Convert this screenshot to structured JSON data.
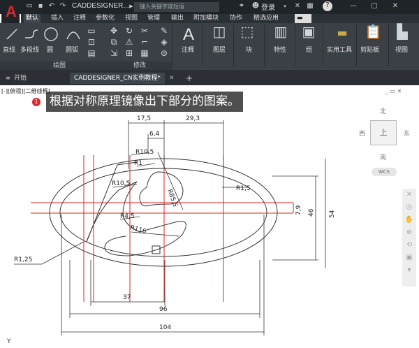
{
  "titlebar": {
    "app_title": "CADDESIGNER...",
    "search_placeholder": "键入关键字或短语",
    "login": "登录",
    "help": "?"
  },
  "menu_tabs": [
    "默认",
    "插入",
    "注释",
    "参数化",
    "视图",
    "管理",
    "输出",
    "附加模块",
    "协作",
    "精选应用"
  ],
  "ribbon": {
    "draw_tools": [
      "直线",
      "多段线",
      "圆",
      "圆弧"
    ],
    "panel_labels": {
      "draw": "绘图",
      "modify": "修改"
    },
    "big_buttons": [
      "注释",
      "图层",
      "块",
      "特性",
      "组",
      "实用工具",
      "剪贴板",
      "视图"
    ]
  },
  "file_tabs": {
    "start": "开始",
    "drawing": "CADDESIGNER_CN实例教程*",
    "add": "+"
  },
  "viewport": {
    "view_label": "[-][俯视][二维线框]",
    "badge": "1",
    "banner": "根据对称原理镜像出下部分的图案。",
    "viewcube": {
      "north": "北",
      "south": "南",
      "west": "西",
      "east": "东",
      "top": "上"
    },
    "wcs": "WCS",
    "ucs_y": "Y",
    "window_buttons": "_ ▭ ✕"
  },
  "drawing": {
    "dims": {
      "d17_5": "17,5",
      "d29_3": "29,3",
      "d6_4": "6,4",
      "d7_9": "7,9",
      "d46": "46",
      "d54": "54",
      "d37": "37",
      "d96": "96",
      "d104": "104"
    },
    "radii": {
      "r10_5a": "R10,5",
      "r1": "R1",
      "r10_5b": "R10,5",
      "r85_5": "R85,5",
      "r1_5": "R1,5",
      "r4_5": "R4,5",
      "r116": "R116",
      "r1_25": "R1,25"
    }
  }
}
